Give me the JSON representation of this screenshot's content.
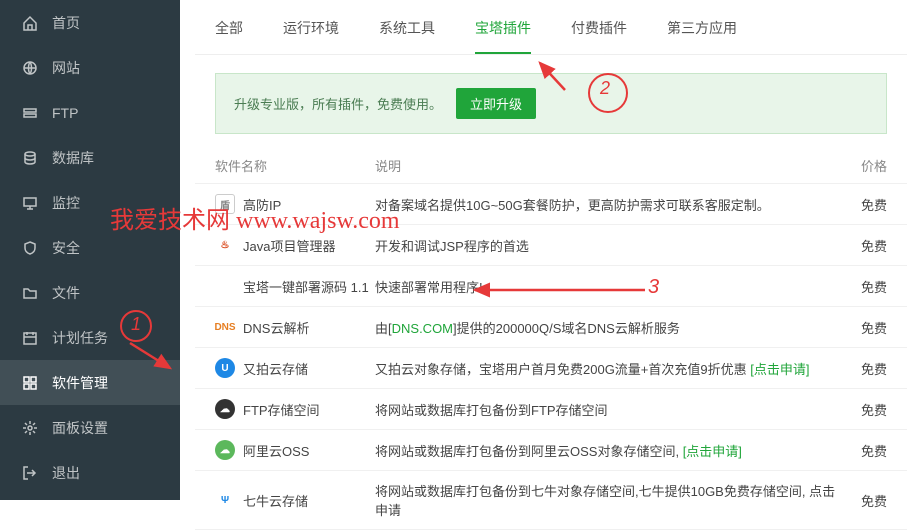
{
  "sidebar": {
    "items": [
      {
        "label": "首页",
        "icon": "home"
      },
      {
        "label": "网站",
        "icon": "globe"
      },
      {
        "label": "FTP",
        "icon": "ftp"
      },
      {
        "label": "数据库",
        "icon": "database"
      },
      {
        "label": "监控",
        "icon": "monitor"
      },
      {
        "label": "安全",
        "icon": "shield"
      },
      {
        "label": "文件",
        "icon": "folder"
      },
      {
        "label": "计划任务",
        "icon": "calendar"
      },
      {
        "label": "软件管理",
        "icon": "grid",
        "active": true
      },
      {
        "label": "面板设置",
        "icon": "settings"
      },
      {
        "label": "退出",
        "icon": "logout"
      }
    ]
  },
  "tabs": [
    {
      "label": "全部"
    },
    {
      "label": "运行环境"
    },
    {
      "label": "系统工具"
    },
    {
      "label": "宝塔插件",
      "active": true
    },
    {
      "label": "付费插件"
    },
    {
      "label": "第三方应用"
    }
  ],
  "banner": {
    "text": "升级专业版，所有插件，免费使用。",
    "button": "立即升级"
  },
  "table": {
    "headers": {
      "name": "软件名称",
      "desc": "说明",
      "price": "价格"
    },
    "rows": [
      {
        "icon_text": "盾",
        "icon_bg": "#fff",
        "icon_border": "#ccc",
        "icon_color": "#888",
        "name": "高防IP",
        "desc": "对备案域名提供10G~50G套餐防护，更高防护需求可联系客服定制。",
        "price": "免费"
      },
      {
        "icon_text": "♨",
        "icon_bg": "#fff",
        "icon_color": "#d84315",
        "name": "Java项目管理器",
        "desc": "开发和调试JSP程序的首选",
        "price": "免费"
      },
      {
        "icon_text": "</>",
        "icon_bg": "#fff",
        "icon_color": "#555",
        "name": "宝塔一键部署源码 1.1",
        "desc": "快速部署常用程序!",
        "price": "免费"
      },
      {
        "icon_text": "DNS",
        "icon_bg": "#fff",
        "icon_color": "#e67e22",
        "name": "DNS云解析",
        "desc_pre": "由[",
        "desc_link": "DNS.COM",
        "desc_post": "]提供的200000Q/S域名DNS云解析服务",
        "price": "免费"
      },
      {
        "icon_text": "U",
        "icon_bg": "#1e88e5",
        "icon_color": "#fff",
        "round": true,
        "name": "又拍云存储",
        "desc_pre": "又拍云对象存储，宝塔用户首月免费200G流量+首次充值9折优惠 ",
        "desc_link": "[点击申请]",
        "price": "免费"
      },
      {
        "icon_text": "☁",
        "icon_bg": "#333",
        "icon_color": "#fff",
        "round": true,
        "name": "FTP存储空间",
        "desc": "将网站或数据库打包备份到FTP存储空间",
        "price": "免费"
      },
      {
        "icon_text": "☁",
        "icon_bg": "#5cb85c",
        "icon_color": "#fff",
        "round": true,
        "name": "阿里云OSS",
        "desc_pre": "将网站或数据库打包备份到阿里云OSS对象存储空间, ",
        "desc_link": "[点击申请]",
        "price": "免费"
      },
      {
        "icon_text": "Ψ",
        "icon_bg": "#fff",
        "icon_color": "#1e88e5",
        "name": "七牛云存储",
        "desc": "将网站或数据库打包备份到七牛对象存储空间,七牛提供10GB免费存储空间, 点击申请",
        "price": "免费"
      }
    ]
  },
  "watermark": "我爱技术网 www.wajsw.com",
  "annotations": {
    "n1": "1",
    "n2": "2",
    "n3": "3"
  }
}
